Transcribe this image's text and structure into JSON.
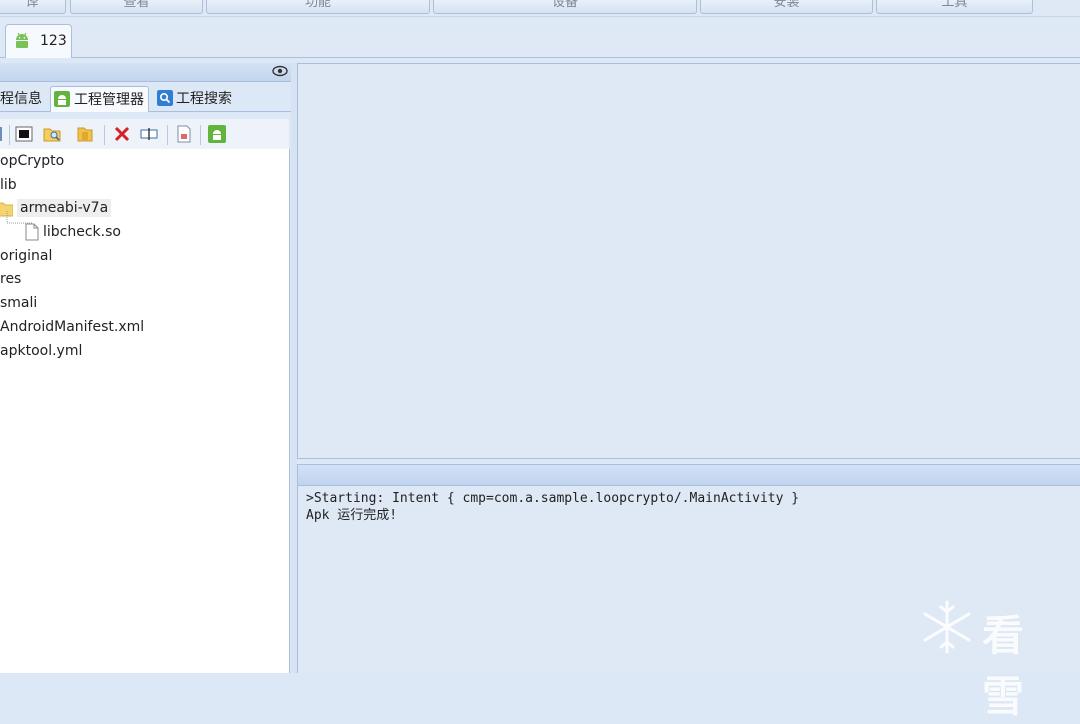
{
  "menu": {
    "items": [
      "译",
      "查看",
      "功能",
      "设备",
      "安装",
      "工具"
    ]
  },
  "project_tab": {
    "label": "123"
  },
  "left_panel": {
    "subtabs": [
      "程信息",
      "工程管理器",
      "工程搜索"
    ]
  },
  "tree": {
    "nodes": [
      "opCrypto",
      "lib",
      "armeabi-v7a",
      "libcheck.so",
      "original",
      "res",
      "smali",
      "AndroidManifest.xml",
      "apktool.yml"
    ]
  },
  "log": {
    "lines": [
      ">Starting: Intent { cmp=com.a.sample.loopcrypto/.MainActivity }",
      "Apk 运行完成!"
    ]
  },
  "watermark": {
    "text": "看雪"
  },
  "colors": {
    "accent_green": "#78c257",
    "delete_red": "#d8202a",
    "folder_yellow": "#f4cd5c"
  },
  "icons": {
    "toolbar": [
      "refresh-icon",
      "terminal-icon",
      "open-folder-search-icon",
      "folder-icon",
      "delete-icon",
      "rename-icon",
      "document-icon",
      "android-icon"
    ]
  }
}
